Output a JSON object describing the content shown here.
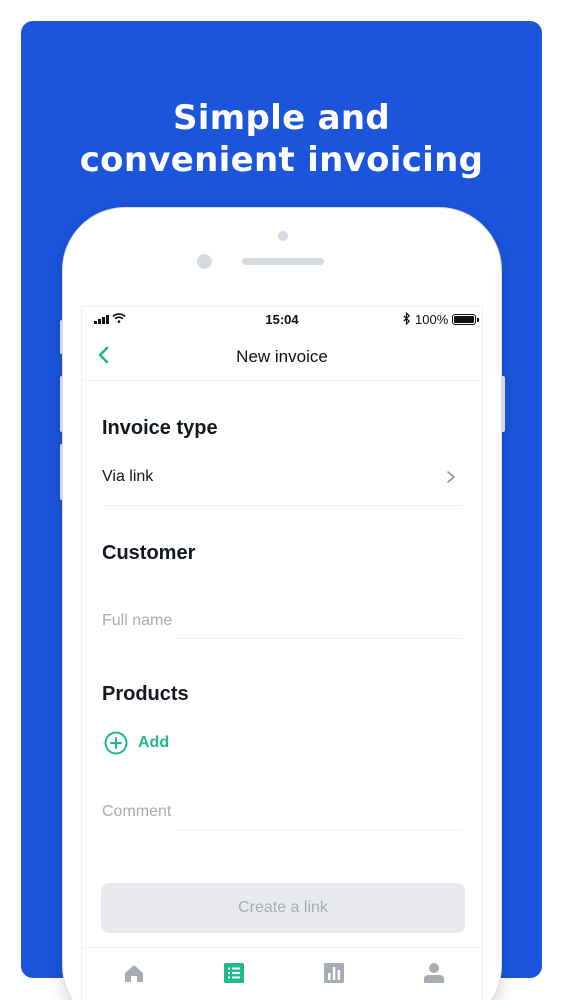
{
  "promo": {
    "headline_line1": "Simple and",
    "headline_line2": "convenient invoicing",
    "background_color": "#1b55dc"
  },
  "status_bar": {
    "time": "15:04",
    "bluetooth": "bluetooth-icon",
    "battery_percent": "100%"
  },
  "nav": {
    "title": "New invoice",
    "back_icon": "chevron-left-icon"
  },
  "invoice_type": {
    "title": "Invoice type",
    "value": "Via link"
  },
  "customer": {
    "title": "Customer",
    "full_name_placeholder": "Full name",
    "full_name_value": ""
  },
  "products": {
    "title": "Products",
    "add_label": "Add"
  },
  "comment": {
    "placeholder": "Comment",
    "value": ""
  },
  "create_button_label": "Create a link",
  "tabs": [
    {
      "icon": "home-icon",
      "active": false
    },
    {
      "icon": "list-icon",
      "active": true
    },
    {
      "icon": "chart-icon",
      "active": false
    },
    {
      "icon": "profile-icon",
      "active": false
    }
  ],
  "colors": {
    "accent": "#1fba8f",
    "inactive_icon": "#a8adb5",
    "disabled_button_bg": "#e9eaee"
  }
}
